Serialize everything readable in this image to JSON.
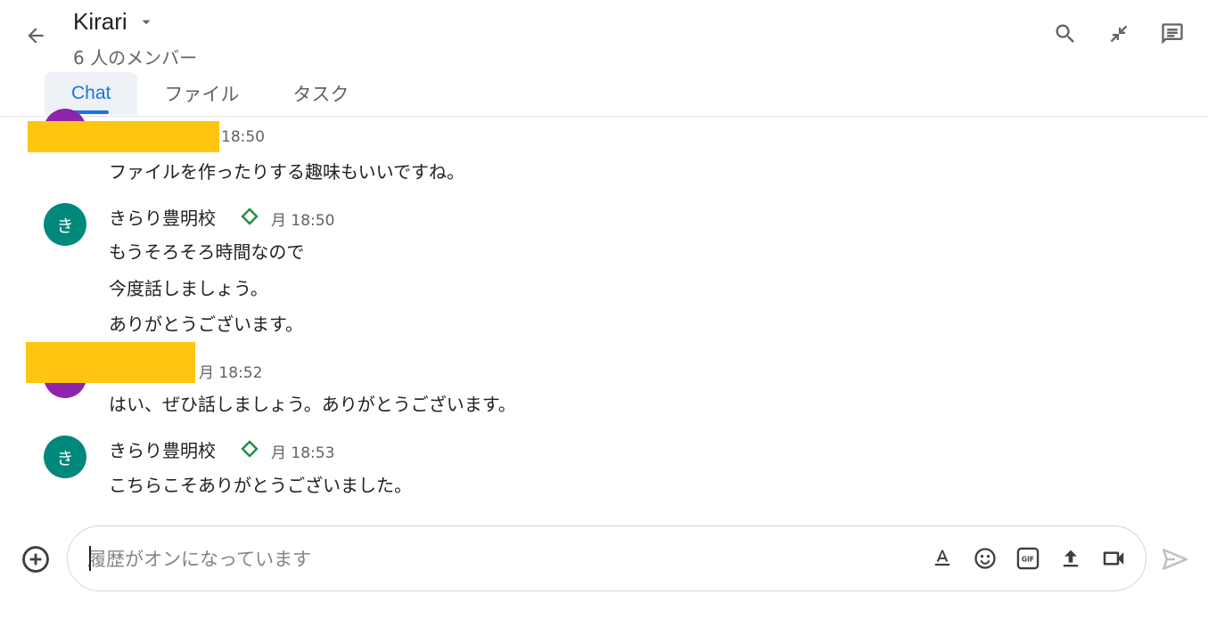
{
  "header": {
    "title": "Kirari",
    "members": "6 人のメンバー"
  },
  "tabs": [
    {
      "label": "Chat",
      "active": true
    },
    {
      "label": "ファイル",
      "active": false
    },
    {
      "label": "タスク",
      "active": false
    }
  ],
  "messages": [
    {
      "sender": "",
      "avatar_initial": "",
      "time": "18:50",
      "lines": [
        "ファイルを作ったりする趣味もいいですね。"
      ]
    },
    {
      "sender": "きらり豊明校",
      "avatar_initial": "き",
      "time": "月 18:50",
      "lines": [
        "もうそろそろ時間なので",
        "今度話しましょう。",
        "ありがとうございます。"
      ]
    },
    {
      "sender": "",
      "avatar_initial": "",
      "time": "月 18:52",
      "lines": [
        "はい、ぜひ話しましょう。ありがとうございます。"
      ]
    },
    {
      "sender": "きらり豊明校",
      "avatar_initial": "き",
      "time": "月 18:53",
      "lines": [
        "こちらこそありがとうございました。"
      ]
    }
  ],
  "composer": {
    "placeholder": "履歴がオンになっています",
    "value": "",
    "gif_label": "GIF"
  },
  "icons": {
    "back": "arrow-back-icon",
    "dropdown": "caret-down-icon",
    "search": "search-icon",
    "minimize": "collapse-icon",
    "threads": "chat-threads-icon",
    "add": "add-circle-icon",
    "format": "text-format-icon",
    "emoji": "emoji-icon",
    "gif": "gif-icon",
    "upload": "upload-icon",
    "video": "video-call-icon",
    "send": "send-icon"
  },
  "colors": {
    "accent": "#1a73e8",
    "redaction": "#ffc511",
    "avatar_teal": "#00897b",
    "avatar_purple": "#8e24aa",
    "verified_diamond": "#1e8e3e"
  }
}
